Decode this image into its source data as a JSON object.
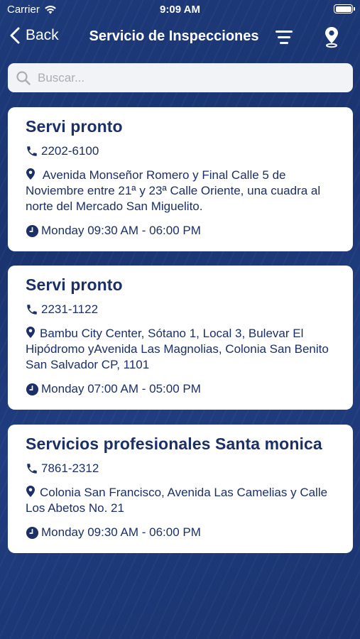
{
  "status_bar": {
    "carrier": "Carrier",
    "time": "9:09 AM"
  },
  "nav": {
    "back_label": "Back",
    "title": "Servicio de Inspecciones"
  },
  "search": {
    "placeholder": "Buscar..."
  },
  "colors": {
    "accent": "#1c2f66",
    "background": "#1d3a7a",
    "card": "#ffffff"
  },
  "results": [
    {
      "name": "Servi pronto",
      "phone": "2202-6100",
      "address": " Avenida Monseñor Romero y Final Calle 5 de Noviembre entre 21ª y 23ª Calle Oriente, una cuadra al norte del Mercado San Miguelito.",
      "hours": "Monday 09:30 AM - 06:00 PM"
    },
    {
      "name": "Servi pronto",
      "phone": "2231-1122",
      "address": "Bambu City Center, Sótano 1, Local 3, Bulevar El Hipódromo yAvenida Las Magnolias, Colonia San Benito San Salvador CP, 1101",
      "hours": "Monday 07:00 AM - 05:00 PM"
    },
    {
      "name": "Servicios profesionales Santa monica",
      "phone": "7861-2312",
      "address": "Colonia San Francisco, Avenida Las Camelias y Calle Los Abetos No. 21",
      "hours": "Monday 09:30 AM - 06:00 PM"
    }
  ]
}
